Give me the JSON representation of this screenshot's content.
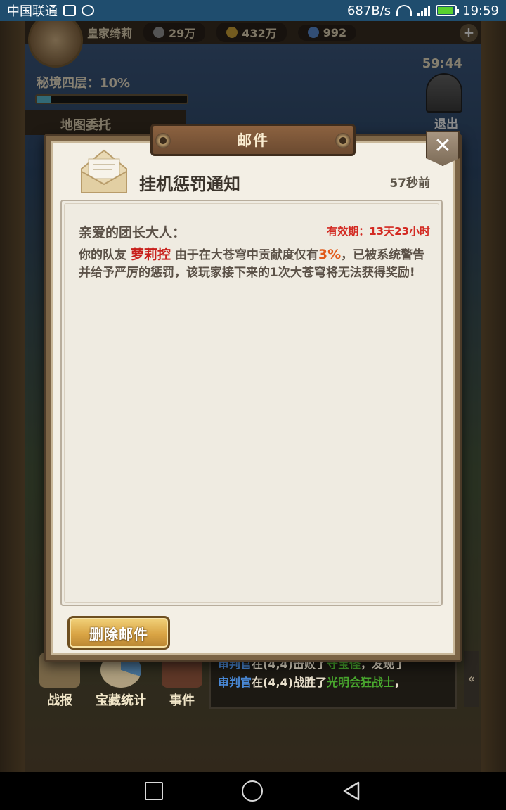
{
  "status_bar": {
    "carrier": "中国联通",
    "net_speed": "687B/s",
    "network_type": "4G",
    "time": "19:59",
    "icons": [
      "image-icon",
      "sync-icon",
      "wifi-icon",
      "signal-icon",
      "battery-charging-icon"
    ]
  },
  "game_header": {
    "player_name": "皇家绮莉",
    "combat_power": "29万",
    "gold": "432万",
    "gems": "992",
    "add_button": "+",
    "dungeon_floor": "秘境四层：10%",
    "progress": 0.1,
    "timer": "59:44",
    "exit_label": "退出",
    "map_tab": "地图委托"
  },
  "bottom_menu": {
    "items": [
      {
        "label": "战报"
      },
      {
        "label": "宝藏统计"
      },
      {
        "label": "事件"
      }
    ],
    "log": [
      {
        "actor": "审判官",
        "text1": "在(4,4)击败了",
        "target": "守宝怪",
        "text2": "，发现了"
      },
      {
        "actor": "审判官",
        "text1": "在(4,4)战胜了",
        "target": "光明会狂战士",
        "text2": "，"
      }
    ],
    "collapse_glyph": "«"
  },
  "mail": {
    "title": "邮件",
    "close_glyph": "✕",
    "subject": "挂机惩罚通知",
    "time_ago": "57秒前",
    "greeting": "亲爱的团长大人：",
    "validity": "有效期：13天23小时",
    "body_prefix": "你的队友 ",
    "teammate": "萝莉控",
    "body_mid": " 由于在大苍穹中贡献度仅有",
    "percent": "3%",
    "body_suffix": "，已被系统警告并给予严厉的惩罚，该玩家接下来的1次大苍穹将无法获得奖励!",
    "delete_button": "删除邮件"
  },
  "colors": {
    "status_bar_bg": "#1f4d6e",
    "highlight_red": "#c8201c",
    "highlight_orange": "#e15a1a",
    "validity_red": "#d32a22",
    "button_gold": "#d9a444"
  }
}
